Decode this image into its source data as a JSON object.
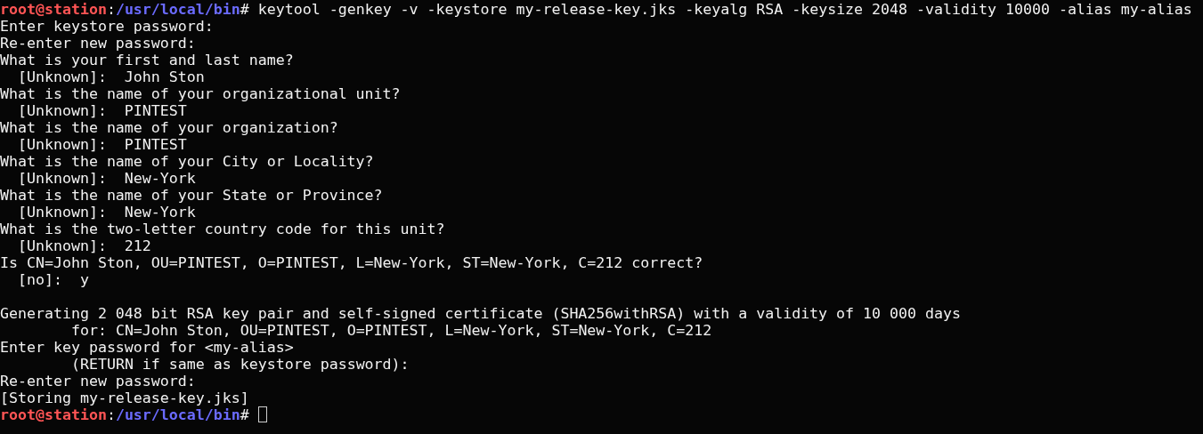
{
  "terminal": {
    "lines": [
      {
        "kind": "prompt",
        "user": "root@station",
        "separator": ":",
        "path": "/usr/local/bin",
        "symbol": "#",
        "command": "keytool -genkey -v -keystore my-release-key.jks -keyalg RSA -keysize 2048 -validity 10000 -alias my-alias"
      },
      {
        "kind": "output",
        "text": "Enter keystore password:"
      },
      {
        "kind": "output",
        "text": "Re-enter new password:"
      },
      {
        "kind": "output",
        "text": "What is your first and last name?"
      },
      {
        "kind": "output",
        "text": "  [Unknown]:  John Ston"
      },
      {
        "kind": "output",
        "text": "What is the name of your organizational unit?"
      },
      {
        "kind": "output",
        "text": "  [Unknown]:  PINTEST"
      },
      {
        "kind": "output",
        "text": "What is the name of your organization?"
      },
      {
        "kind": "output",
        "text": "  [Unknown]:  PINTEST"
      },
      {
        "kind": "output",
        "text": "What is the name of your City or Locality?"
      },
      {
        "kind": "output",
        "text": "  [Unknown]:  New-York"
      },
      {
        "kind": "output",
        "text": "What is the name of your State or Province?"
      },
      {
        "kind": "output",
        "text": "  [Unknown]:  New-York"
      },
      {
        "kind": "output",
        "text": "What is the two-letter country code for this unit?"
      },
      {
        "kind": "output",
        "text": "  [Unknown]:  212"
      },
      {
        "kind": "output",
        "text": "Is CN=John Ston, OU=PINTEST, O=PINTEST, L=New-York, ST=New-York, C=212 correct?"
      },
      {
        "kind": "output",
        "text": "  [no]:  y"
      },
      {
        "kind": "blank"
      },
      {
        "kind": "output",
        "text": "Generating 2 048 bit RSA key pair and self-signed certificate (SHA256withRSA) with a validity of 10 000 days"
      },
      {
        "kind": "output",
        "text": "\tfor: CN=John Ston, OU=PINTEST, O=PINTEST, L=New-York, ST=New-York, C=212"
      },
      {
        "kind": "output",
        "text": "Enter key password for <my-alias>"
      },
      {
        "kind": "output",
        "text": "\t(RETURN if same as keystore password):"
      },
      {
        "kind": "output",
        "text": "Re-enter new password:"
      },
      {
        "kind": "output",
        "text": "[Storing my-release-key.jks]"
      },
      {
        "kind": "prompt",
        "user": "root@station",
        "separator": ":",
        "path": "/usr/local/bin",
        "symbol": "#",
        "cursor": true
      }
    ]
  }
}
